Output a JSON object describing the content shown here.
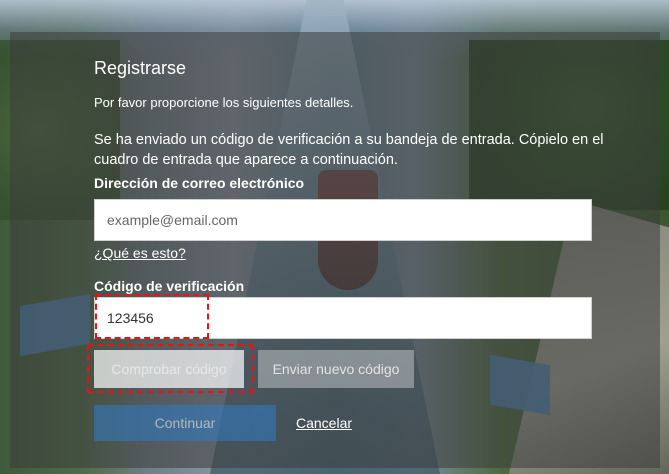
{
  "form": {
    "title": "Registrarse",
    "intro": "Por favor proporcione los siguientes detalles.",
    "info": "Se ha enviado un código de verificación a su bandeja de entrada. Cópielo en el cuadro de entrada que aparece a continuación.",
    "email_label": "Dirección de correo electrónico",
    "email_placeholder": "example@email.com",
    "what_link": "¿Qué es esto?",
    "code_label": "Código de verificación",
    "code_value": "123456",
    "check_button": "Comprobar código",
    "resend_button": "Enviar nuevo código",
    "continue_button": "Continuar",
    "cancel_link": "Cancelar"
  }
}
